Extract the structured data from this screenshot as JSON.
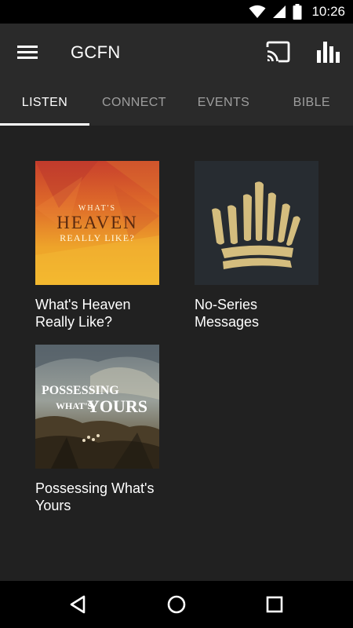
{
  "status_bar": {
    "time": "10:26",
    "icons": [
      "wifi-icon",
      "signal-icon",
      "battery-icon"
    ]
  },
  "app_bar": {
    "title": "GCFN",
    "icons": [
      "menu-icon",
      "cast-icon",
      "bar-chart-icon"
    ]
  },
  "tabs": [
    {
      "label": "LISTEN",
      "active": true
    },
    {
      "label": "CONNECT",
      "active": false
    },
    {
      "label": "EVENTS",
      "active": false
    },
    {
      "label": "BIBLE",
      "active": false
    }
  ],
  "series": [
    {
      "label": "What's Heaven Really Like?",
      "art": {
        "line1": "WHAT'S",
        "line2": "HEAVEN",
        "line3": "REALLY LIKE?"
      }
    },
    {
      "label": "No-Series Messages",
      "art": {
        "icon": "crown-icon"
      }
    },
    {
      "label": "Possessing What's Yours",
      "art": {
        "line1": "POSSESSING",
        "line2": "WHAT'S",
        "line3": "YOURS"
      }
    }
  ],
  "nav_bar": {
    "icons": [
      "back-icon",
      "home-icon",
      "recents-icon"
    ]
  },
  "colors": {
    "background": "#212121",
    "app_bar": "#2a2a2a",
    "tab_active": "#ffffff",
    "tab_inactive": "#9e9e9e",
    "crown_gold": "#d4bd7e"
  }
}
